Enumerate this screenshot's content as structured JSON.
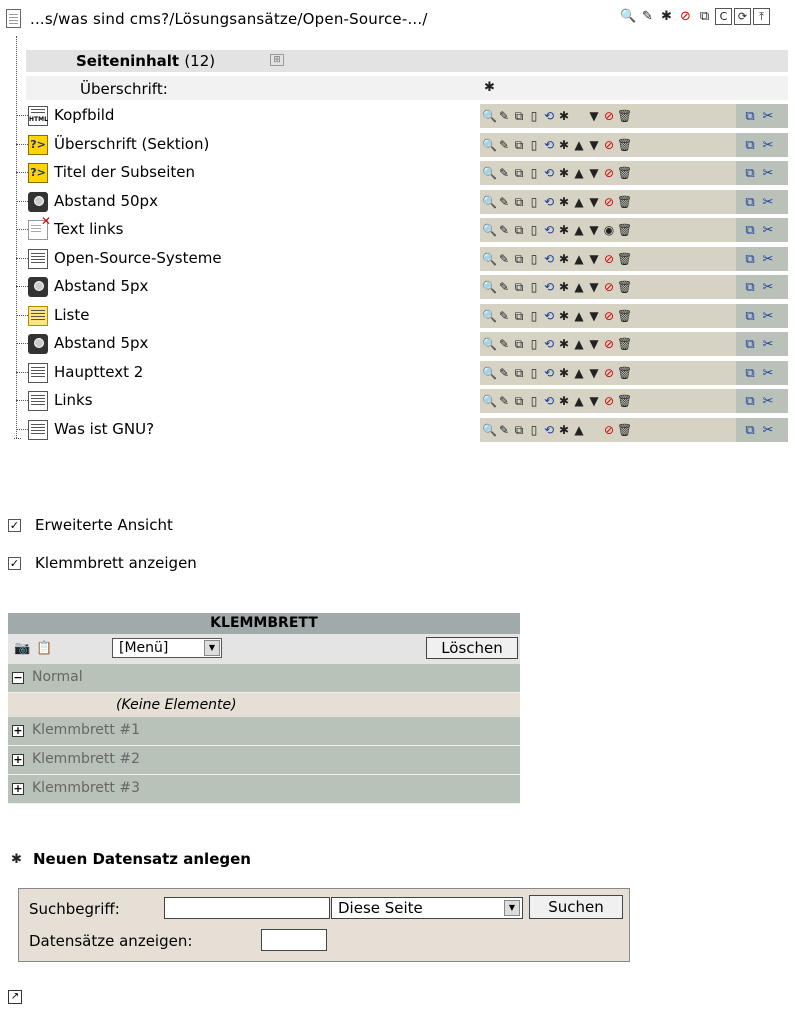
{
  "path": {
    "text": "...s/was sind cms?/Lösungsansätze/Open-Source-.../"
  },
  "path_tools": [
    {
      "name": "magnifier-icon",
      "glyph": "🔍"
    },
    {
      "name": "pencil-icon",
      "glyph": "✎"
    },
    {
      "name": "new-record-icon",
      "glyph": "✱"
    },
    {
      "name": "hide-icon",
      "glyph": "⊘"
    },
    {
      "name": "page-view-icon",
      "glyph": "⧉"
    },
    {
      "name": "clear-cache-icon",
      "glyph": "C"
    },
    {
      "name": "reload-icon",
      "glyph": "⟳"
    },
    {
      "name": "up-icon",
      "glyph": "⤒"
    }
  ],
  "content": {
    "title": "Seiteninhalt",
    "count": "(12)",
    "heading_label": "Überschrift:"
  },
  "rows": [
    {
      "label": "Kopfbild",
      "type": "html",
      "up": false,
      "hidden_state": "normal"
    },
    {
      "label": "Überschrift (Sektion)",
      "type": "q",
      "up": true,
      "hidden_state": "normal"
    },
    {
      "label": "Titel der Subseiten",
      "type": "q",
      "up": true,
      "hidden_state": "normal"
    },
    {
      "label": "Abstand 50px",
      "type": "cam",
      "up": true,
      "hidden_state": "normal"
    },
    {
      "label": "Text links",
      "type": "textx",
      "up": true,
      "hidden_state": "unhide"
    },
    {
      "label": "Open-Source-Systeme",
      "type": "text",
      "up": true,
      "hidden_state": "normal"
    },
    {
      "label": "Abstand 5px",
      "type": "cam",
      "up": true,
      "hidden_state": "normal"
    },
    {
      "label": "Liste",
      "type": "list",
      "up": true,
      "hidden_state": "normal"
    },
    {
      "label": "Abstand 5px",
      "type": "cam",
      "up": true,
      "hidden_state": "normal"
    },
    {
      "label": "Haupttext 2",
      "type": "text",
      "up": true,
      "hidden_state": "normal"
    },
    {
      "label": "Links",
      "type": "text",
      "up": true,
      "hidden_state": "normal"
    },
    {
      "label": "Was ist GNU?",
      "type": "text",
      "up": true,
      "down": false,
      "hidden_state": "normal"
    }
  ],
  "options": {
    "extended_view": "Erweiterte Ansicht",
    "show_clipboard": "Klemmbrett anzeigen"
  },
  "clipboard": {
    "title": "KLEMMBRETT",
    "menu": "[Menü]",
    "clear": "Löschen",
    "normal": "Normal",
    "empty": "(Keine Elemente)",
    "pads": [
      "Klemmbrett #1",
      "Klemmbrett #2",
      "Klemmbrett #3"
    ]
  },
  "new_record": "Neuen Datensatz anlegen",
  "search": {
    "term_label": "Suchbegriff:",
    "scope": "Diese Seite",
    "button": "Suchen",
    "show_label": "Datensätze anzeigen:"
  }
}
